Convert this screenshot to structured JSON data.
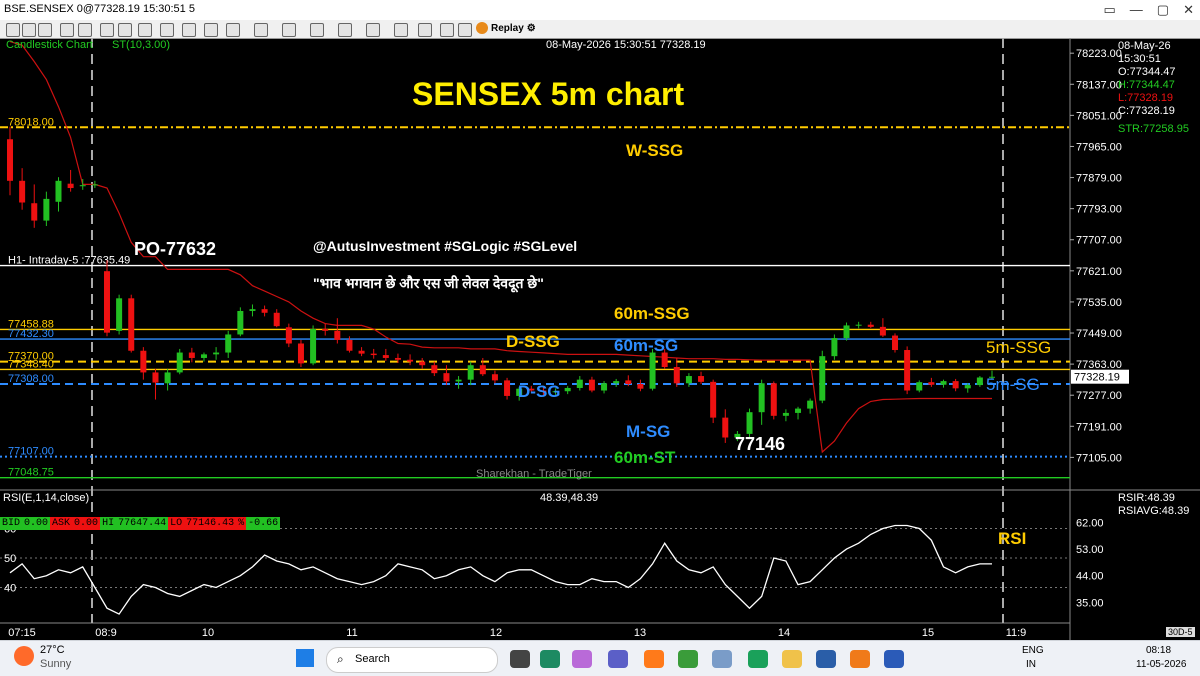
{
  "window": {
    "title": "BSE.SENSEX 0@77328.19 15:30:51 5",
    "controls": [
      "▭",
      "—",
      "▢",
      "✕"
    ]
  },
  "toolbar": {
    "replay_label": "Replay"
  },
  "chart_header": {
    "type_label": "Candlestick Chart",
    "indicator_label": "ST(10,3.00)",
    "datetime_label": "08-May-2026 15:30:51 77328.19"
  },
  "info_panel": {
    "date": "08-May-26",
    "time": "15:30:51",
    "open": "O:77344.47",
    "high": "H:77344.47",
    "low": "L:77328.19",
    "close": "C:77328.19",
    "str": "STR:77258.95"
  },
  "price_axis": {
    "ticks": [
      "78223.00",
      "78137.00",
      "78051.00",
      "77965.00",
      "77879.00",
      "77793.00",
      "77707.00",
      "77621.00",
      "77535.00",
      "77449.00",
      "77363.00",
      "77277.00",
      "77191.00",
      "77105.00"
    ],
    "current_price": "77328.19"
  },
  "rsi_axis": {
    "ticks": [
      "62.00",
      "53.00",
      "44.00",
      "35.00"
    ],
    "left_ticks": [
      "60",
      "50",
      "40"
    ],
    "rsir": "RSIR:48.39",
    "rsiavg": "RSIAVG:48.39"
  },
  "time_axis": [
    "07:15",
    "08:9",
    "10",
    "11",
    "12",
    "13",
    "14",
    "15",
    "11:9"
  ],
  "colors": {
    "bull": "#22c022",
    "bear": "#ee1111",
    "supertrend": "#cc1111",
    "rsi": "#ffffff",
    "ssg": "#ffcc00",
    "sg": "#2e8cff",
    "st60": "#22cc22"
  },
  "levels": [
    {
      "label": "78018.00",
      "value": 78018,
      "color": "#ffcc00",
      "style": "dashdot",
      "label_color": "#ffcc00"
    },
    {
      "label": "H1- Intraday-5 :77635.49",
      "value": 77635.49,
      "color": "#ffffff",
      "style": "solid",
      "label_color": "#ffffff"
    },
    {
      "label": "77458.88",
      "value": 77458.88,
      "color": "#ffcc00",
      "style": "solid",
      "label_color": "#ffcc00"
    },
    {
      "label": "77432.30",
      "value": 77432.3,
      "color": "#2e8cff",
      "style": "solid",
      "label_color": "#2e8cff"
    },
    {
      "label": "77370.00",
      "value": 77370,
      "color": "#ffcc00",
      "style": "dashed",
      "label_color": "#ffcc00"
    },
    {
      "label": "77348.40",
      "value": 77348.4,
      "color": "#ffcc00",
      "style": "solid",
      "label_color": "#ffcc00"
    },
    {
      "label": "77308.00",
      "value": 77308,
      "color": "#2e8cff",
      "style": "dashed",
      "label_color": "#2e8cff"
    },
    {
      "label": "77107.00",
      "value": 77107,
      "color": "#2e8cff",
      "style": "dotted",
      "label_color": "#2e8cff"
    },
    {
      "label": "77048.75",
      "value": 77048.75,
      "color": "#22cc22",
      "style": "solid",
      "label_color": "#22cc22"
    }
  ],
  "annotations": {
    "title": "SENSEX 5m chart",
    "handle": "@AutusInvestment #SGLogic #SGLevel",
    "quote": "\"भाव भगवान छे और एस जी लेवल देवदूत छे\"",
    "po": "PO-77632",
    "w_ssg": "W-SSG",
    "ssg60": "60m-SSG",
    "sg60": "60m-SG",
    "d_ssg": "D-SSG",
    "d_sg": "D-SG",
    "m_sg": "M-SG",
    "low": "77146",
    "st60": "60m-ST",
    "ssg5": "5m-SSG",
    "sg5": "5m-SG",
    "rsi": "RSI",
    "watermark": "Sharekhan - TradeTiger",
    "rsi_value": "48.39,48.39"
  },
  "bid_bar": {
    "bid_label": "BID",
    "bid": "0.00",
    "ask_label": "ASK",
    "ask": "0.00",
    "hi_label": "HI",
    "hi": "77647.44",
    "lo_label": "LO",
    "lo": "77146.43",
    "pct_label": "%",
    "pct": "-0.66"
  },
  "rsi_label": "RSI(E,1,14,close)",
  "corner_label": "30D-5",
  "chart_data": {
    "type": "candlestick",
    "title": "SENSEX 5m chart",
    "ylim": [
      77048,
      78265
    ],
    "candles": [
      [
        77985,
        78020,
        77830,
        77870
      ],
      [
        77870,
        77905,
        77790,
        77810
      ],
      [
        77808,
        77860,
        77740,
        77760
      ],
      [
        77760,
        77840,
        77745,
        77820
      ],
      [
        77812,
        77880,
        77785,
        77870
      ],
      [
        77862,
        77900,
        77840,
        77850
      ],
      [
        77855,
        77875,
        77845,
        77858
      ],
      [
        77858,
        77870,
        77850,
        77860
      ],
      [
        77620,
        77650,
        77440,
        77450
      ],
      [
        77455,
        77555,
        77445,
        77545
      ],
      [
        77545,
        77555,
        77395,
        77400
      ],
      [
        77400,
        77410,
        77320,
        77340
      ],
      [
        77340,
        77350,
        77265,
        77312
      ],
      [
        77310,
        77350,
        77290,
        77340
      ],
      [
        77340,
        77405,
        77335,
        77395
      ],
      [
        77395,
        77408,
        77368,
        77380
      ],
      [
        77380,
        77395,
        77370,
        77390
      ],
      [
        77390,
        77410,
        77375,
        77395
      ],
      [
        77395,
        77455,
        77380,
        77445
      ],
      [
        77445,
        77520,
        77440,
        77510
      ],
      [
        77510,
        77528,
        77495,
        77515
      ],
      [
        77515,
        77525,
        77495,
        77505
      ],
      [
        77505,
        77515,
        77465,
        77468
      ],
      [
        77465,
        77475,
        77410,
        77420
      ],
      [
        77420,
        77430,
        77355,
        77365
      ],
      [
        77365,
        77470,
        77360,
        77460
      ],
      [
        77460,
        77475,
        77442,
        77455
      ],
      [
        77455,
        77490,
        77420,
        77430
      ],
      [
        77430,
        77440,
        77395,
        77400
      ],
      [
        77400,
        77410,
        77385,
        77392
      ],
      [
        77392,
        77405,
        77378,
        77388
      ],
      [
        77388,
        77405,
        77372,
        77380
      ],
      [
        77380,
        77392,
        77366,
        77375
      ],
      [
        77375,
        77390,
        77360,
        77370
      ],
      [
        77370,
        77380,
        77350,
        77360
      ],
      [
        77360,
        77370,
        77330,
        77338
      ],
      [
        77338,
        77360,
        77305,
        77315
      ],
      [
        77315,
        77330,
        77295,
        77320
      ],
      [
        77320,
        77370,
        77305,
        77360
      ],
      [
        77360,
        77380,
        77330,
        77335
      ],
      [
        77335,
        77345,
        77310,
        77318
      ],
      [
        77318,
        77325,
        77265,
        77275
      ],
      [
        77275,
        77300,
        77262,
        77295
      ],
      [
        77295,
        77303,
        77285,
        77290
      ],
      [
        77290,
        77300,
        77276,
        77286
      ],
      [
        77286,
        77296,
        77278,
        77288
      ],
      [
        77288,
        77302,
        77280,
        77297
      ],
      [
        77297,
        77330,
        77290,
        77320
      ],
      [
        77320,
        77328,
        77285,
        77290
      ],
      [
        77290,
        77316,
        77282,
        77310
      ],
      [
        77310,
        77322,
        77300,
        77316
      ],
      [
        77318,
        77332,
        77302,
        77308
      ],
      [
        77308,
        77320,
        77288,
        77295
      ],
      [
        77295,
        77405,
        77290,
        77395
      ],
      [
        77395,
        77405,
        77350,
        77355
      ],
      [
        77355,
        77380,
        77300,
        77310
      ],
      [
        77310,
        77338,
        77300,
        77330
      ],
      [
        77330,
        77342,
        77308,
        77314
      ],
      [
        77314,
        77320,
        77200,
        77215
      ],
      [
        77215,
        77238,
        77145,
        77160
      ],
      [
        77160,
        77178,
        77150,
        77170
      ],
      [
        77170,
        77240,
        77160,
        77230
      ],
      [
        77230,
        77320,
        77195,
        77310
      ],
      [
        77310,
        77315,
        77210,
        77220
      ],
      [
        77220,
        77238,
        77205,
        77228
      ],
      [
        77228,
        77245,
        77210,
        77240
      ],
      [
        77240,
        77268,
        77226,
        77262
      ],
      [
        77262,
        77400,
        77255,
        77385
      ],
      [
        77385,
        77445,
        77375,
        77435
      ],
      [
        77435,
        77478,
        77428,
        77470
      ],
      [
        77470,
        77480,
        77462,
        77472
      ],
      [
        77472,
        77480,
        77463,
        77466
      ],
      [
        77466,
        77490,
        77438,
        77442
      ],
      [
        77442,
        77448,
        77395,
        77402
      ],
      [
        77402,
        77412,
        77280,
        77290
      ],
      [
        77290,
        77318,
        77285,
        77313
      ],
      [
        77313,
        77325,
        77300,
        77306
      ],
      [
        77306,
        77320,
        77298,
        77316
      ],
      [
        77316,
        77322,
        77288,
        77296
      ],
      [
        77296,
        77310,
        77284,
        77305
      ],
      [
        77305,
        77330,
        77300,
        77326
      ],
      [
        77326,
        77345,
        77320,
        77328
      ]
    ],
    "supertrend": [
      78255,
      78245,
      78200,
      78150,
      78075,
      77990,
      77860,
      77860,
      77850,
      77780,
      77700,
      77660,
      77660,
      77625,
      77625,
      77625,
      77625,
      77625,
      77625,
      77610,
      77580,
      77565,
      77550,
      77535,
      77510,
      77490,
      77475,
      77470,
      77470,
      77470,
      77460,
      77438,
      77420,
      77418,
      77410,
      77408,
      77408,
      77408,
      77405,
      77405,
      77405,
      77400,
      77398,
      77396,
      77394,
      77392,
      77390,
      77390,
      77390,
      77390,
      77390,
      77388,
      77386,
      77384,
      77382,
      77380,
      77378,
      77378,
      77378,
      77376,
      77376,
      77375,
      77374,
      77374,
      77374,
      77374,
      77374,
      77120,
      77150,
      77200,
      77240,
      77260,
      77265,
      77266,
      77267,
      77268,
      77268,
      77268,
      77268,
      77268,
      77268,
      77268
    ],
    "rsi": [
      45,
      48,
      43,
      44,
      46,
      45,
      47,
      40,
      33,
      31,
      37,
      41,
      40,
      38,
      37,
      39,
      41,
      40,
      42,
      44,
      47,
      51,
      49,
      48,
      46,
      47,
      45,
      43,
      42,
      41,
      42,
      44,
      48,
      47,
      46,
      43,
      44,
      46,
      47,
      44,
      42,
      45,
      46,
      46,
      44,
      42,
      41,
      41,
      43,
      42,
      42,
      40,
      43,
      48,
      55,
      49,
      46,
      45,
      47,
      41,
      37,
      33,
      37,
      50,
      49,
      41,
      42,
      46,
      50,
      53,
      55,
      58,
      60,
      61,
      61,
      60,
      56,
      47,
      45,
      47,
      48,
      48
    ]
  }
}
